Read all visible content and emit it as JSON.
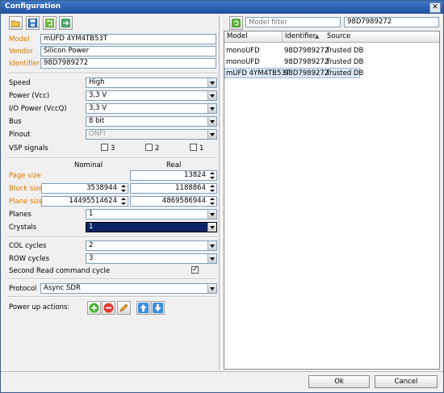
{
  "window": {
    "title": "Configuration",
    "close_glyph": "✕"
  },
  "toolbar": {
    "icons": [
      "open-folder-icon",
      "save-icon",
      "undo-icon",
      "export-icon"
    ]
  },
  "device": {
    "model_label": "Model",
    "model_value": "mUFD 4YM4TB53T",
    "vendor_label": "Vendor",
    "vendor_value": "Silicon Power",
    "identifier_label": "Identifier",
    "identifier_value": "98D7989272"
  },
  "settings": {
    "speed_label": "Speed",
    "speed_value": "High",
    "power_label": "Power (Vcc)",
    "power_value": "3,3 V",
    "io_power_label": "I/O Power (VccQ)",
    "io_power_value": "3,3 V",
    "bus_label": "Bus",
    "bus_value": "8 bit",
    "pinout_label": "Pinout",
    "pinout_value": "ONFI",
    "vsp_label": "VSP signals",
    "vsp_options": [
      "3",
      "2",
      "1"
    ]
  },
  "geometry": {
    "nominal_header": "Nominal",
    "real_header": "Real",
    "page_size_label": "Page size",
    "page_size_real": "13824",
    "block_size_label": "Block size",
    "block_size_nominal": "3538944",
    "block_size_real": "1188864",
    "plane_size_label": "Plane size",
    "plane_size_nominal": "14495514624",
    "plane_size_real": "4869586944",
    "planes_label": "Planes",
    "planes_value": "1",
    "crystals_label": "Crystals",
    "crystals_value": "1"
  },
  "cycles": {
    "col_label": "COL cycles",
    "col_value": "2",
    "row_label": "ROW cycles",
    "row_value": "3",
    "second_read_label": "Second Read command cycle",
    "second_read_checked": true,
    "check_glyph": "✓"
  },
  "protocol": {
    "label": "Protocol",
    "value": "Async SDR"
  },
  "power_up": {
    "label": "Power up actions:"
  },
  "filter": {
    "placeholder": "Model filter",
    "id_value": "98D7989272"
  },
  "table": {
    "columns": [
      "Model",
      "Identifier",
      "Source"
    ],
    "sort_glyph": "▲",
    "rows": [
      {
        "model": "monoUFD",
        "identifier": "98D7989272",
        "source": "Trusted DB"
      },
      {
        "model": "monoUFD",
        "identifier": "98D7989272",
        "source": "Trusted DB"
      },
      {
        "model": "mUFD 4YM4TB53T",
        "identifier": "98D7989272",
        "source": "Trusted DB"
      }
    ]
  },
  "buttons": {
    "ok": "Ok",
    "cancel": "Cancel"
  },
  "colors": {
    "title_bar": "#1f4f9f",
    "accent_label": "#d87a00",
    "selection": "#0a2466"
  }
}
